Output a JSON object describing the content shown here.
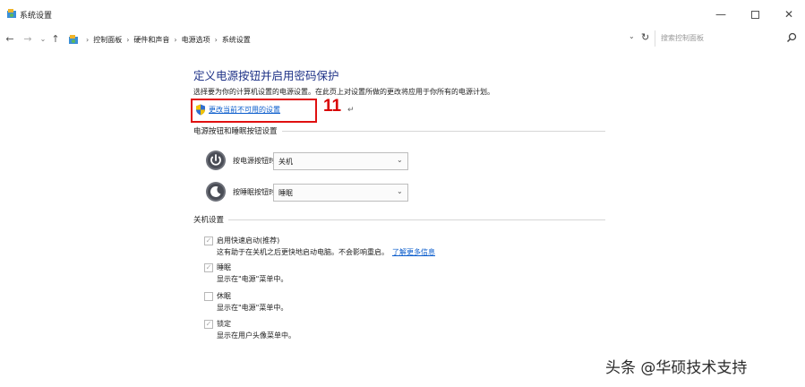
{
  "window": {
    "title": "系统设置",
    "controls": {
      "minimize": "—",
      "maximize": "",
      "close": "✕"
    }
  },
  "nav": {
    "back": "←",
    "forward": "→",
    "recent": "⌄",
    "up": "↑"
  },
  "address": {
    "crumbs": [
      "控制面板",
      "硬件和声音",
      "电源选项",
      "系统设置"
    ],
    "separator": "›",
    "dropdown": "⌄",
    "refresh": "↻"
  },
  "search": {
    "placeholder": "搜索控制面板"
  },
  "content": {
    "title": "定义电源按钮并启用密码保护",
    "description": "选择要为你的计算机设置的电源设置。在此页上对设置所做的更改将应用于你所有的电源计划。",
    "change_link": "更改当前不可用的设置",
    "step_number": "11",
    "return_mark": "↵",
    "power_section": {
      "title": "电源按钮和睡眠按钮设置",
      "rows": [
        {
          "label": "按电源按钮时:",
          "value": "关机",
          "icon": "power-icon"
        },
        {
          "label": "按睡眠按钮时:",
          "value": "睡眠",
          "icon": "sleep-icon"
        }
      ]
    },
    "shutdown_section": {
      "title": "关机设置",
      "items": [
        {
          "label": "启用快速启动(推荐)",
          "sub": "这有助于在关机之后更快地启动电脑。不会影响重启。",
          "link": "了解更多信息",
          "checked": true
        },
        {
          "label": "睡眠",
          "sub": "显示在\"电源\"菜单中。",
          "checked": true
        },
        {
          "label": "休眠",
          "sub": "显示在\"电源\"菜单中。",
          "checked": false
        },
        {
          "label": "锁定",
          "sub": "显示在用户头像菜单中。",
          "checked": true
        }
      ]
    }
  },
  "watermark": "头条 @华硕技术支持",
  "colors": {
    "title_blue": "#1e3287",
    "link_blue": "#0a5ccc",
    "highlight_red": "#e01010"
  }
}
